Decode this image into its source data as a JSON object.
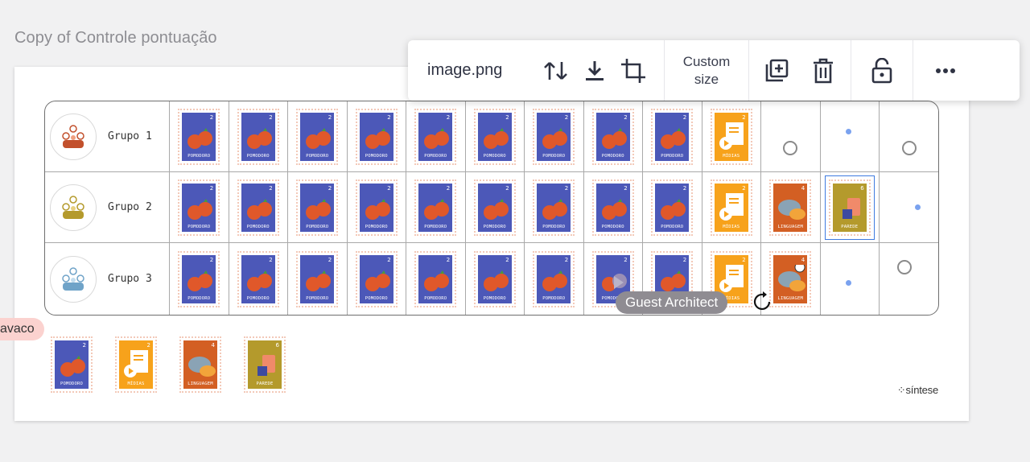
{
  "frame_title": "Copy of Controle pontuação",
  "toolbar": {
    "filename": "image.png",
    "custom_size_line1": "Custom",
    "custom_size_line2": "size",
    "icons": [
      "swap-icon",
      "download-icon",
      "crop-icon",
      "duplicate-icon",
      "delete-icon",
      "lock-icon",
      "more-icon"
    ]
  },
  "groups": [
    {
      "name": "Grupo 1"
    },
    {
      "name": "Grupo 2"
    },
    {
      "name": "Grupo 3"
    }
  ],
  "stamps": {
    "pomodoro": {
      "label": "POMODORO",
      "value": "2"
    },
    "midias": {
      "label": "MÍDIAS",
      "value": "2"
    },
    "linguagem": {
      "label": "LINGUAGEM",
      "value": "4"
    },
    "parede": {
      "label": "PAREDE",
      "value": "6"
    }
  },
  "tag_left": "avaco",
  "tooltip": "Guest Architect",
  "logo": "síntese",
  "colors": {
    "pomodoro": "#4c58b8",
    "midias": "#f7a21b",
    "linguagem": "#d35f23",
    "parede": "#b49a2c",
    "selection": "#3f7be0"
  }
}
